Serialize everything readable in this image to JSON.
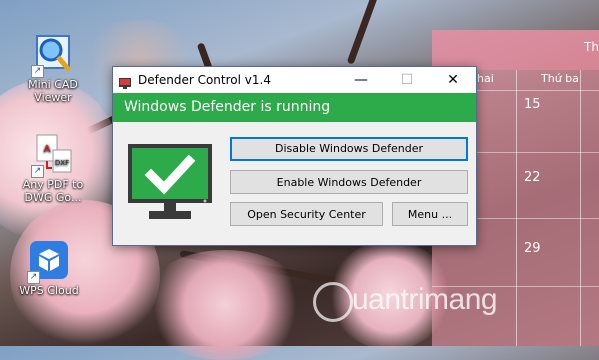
{
  "desktop": {
    "icons": [
      {
        "label": "Mini CAD Viewer",
        "icon": "mini-cad-viewer-icon"
      },
      {
        "label": "Any PDF to DWG Go...",
        "icon": "pdf-to-dwg-icon"
      },
      {
        "label": "WPS Cloud",
        "icon": "wps-cloud-icon"
      }
    ],
    "watermark": "uantrimang"
  },
  "calendar": {
    "title": "Th",
    "day_headers": [
      "hai",
      "Thứ ba"
    ],
    "dates": [
      "15",
      "22",
      "29"
    ]
  },
  "window": {
    "title": "Defender Control v1.4",
    "minimize_symbol": "—",
    "maximize_symbol": "☐",
    "close_symbol": "✕",
    "status": "Windows Defender is running",
    "status_color": "#2daa4a",
    "status_icon": "checkmark-monitor-icon",
    "buttons": {
      "disable": "Disable Windows Defender",
      "enable": "Enable Windows Defender",
      "security_center": "Open Security Center",
      "menu": "Menu ..."
    }
  }
}
